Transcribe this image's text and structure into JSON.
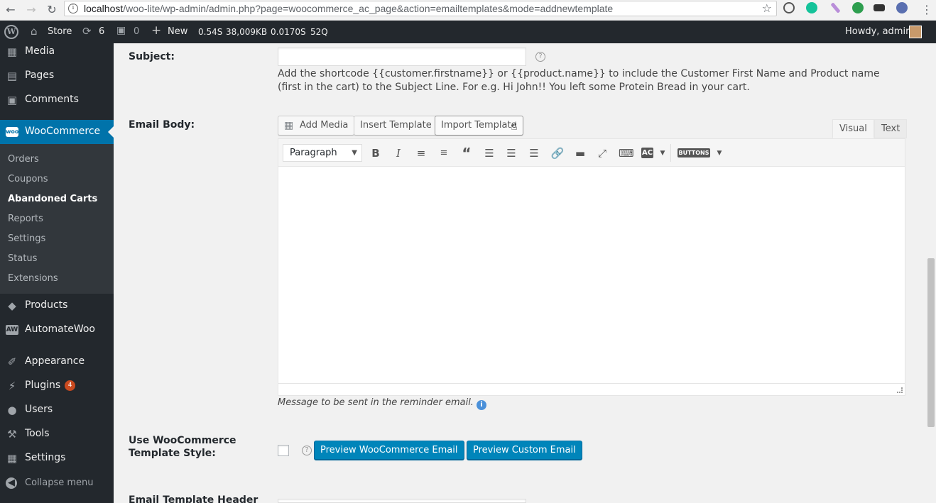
{
  "browser": {
    "url_host": "localhost",
    "url_path": "/woo-lite/wp-admin/admin.php?page=woocommerce_ac_page&action=emailtemplates&mode=addnewtemplate"
  },
  "adminbar": {
    "site_name": "Store",
    "updates_count": "6",
    "comments_count": "0",
    "new_label": "New",
    "stat_time": "0.54S",
    "stat_memory": "38,009KB",
    "stat_query_time": "0.0170S",
    "stat_queries": "52Q",
    "greeting": "Howdy, admin"
  },
  "sidebar": {
    "media": "Media",
    "pages": "Pages",
    "comments": "Comments",
    "woocommerce": "WooCommerce",
    "submenu": [
      "Orders",
      "Coupons",
      "Abandoned Carts",
      "Reports",
      "Settings",
      "Status",
      "Extensions"
    ],
    "products": "Products",
    "automatewoo": "AutomateWoo",
    "appearance": "Appearance",
    "plugins": "Plugins",
    "plugins_badge": "4",
    "users": "Users",
    "tools": "Tools",
    "settings": "Settings",
    "collapse": "Collapse menu"
  },
  "form": {
    "subject_label": "Subject:",
    "subject_value": "",
    "subject_help": "Add the shortcode {{customer.firstname}} or {{product.name}} to include the Customer First Name and Product name (first in the cart) to the Subject Line. For e.g. Hi John!! You left some Protein Bread in your cart.",
    "email_body_label": "Email Body:",
    "add_media": "Add Media",
    "insert_template": "Insert Template",
    "import_template": "Import Template",
    "tab_visual": "Visual",
    "tab_text": "Text",
    "format_select": "Paragraph",
    "buttons_label": "BUTTONS",
    "body_note": "Message to be sent in the reminder email.",
    "woo_style_label_1": "Use WooCommerce",
    "woo_style_label_2": "Template Style:",
    "preview_woo": "Preview WooCommerce Email",
    "preview_custom": "Preview Custom Email",
    "header_label": "Email Template Header"
  }
}
